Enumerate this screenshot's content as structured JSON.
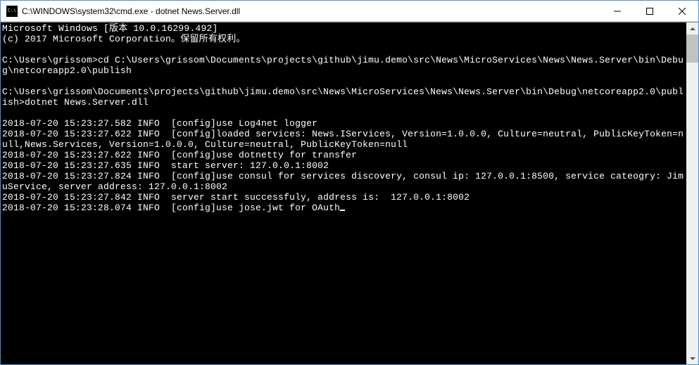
{
  "window": {
    "title": "C:\\WINDOWS\\system32\\cmd.exe - dotnet  News.Server.dll"
  },
  "terminal": {
    "lines": [
      "Microsoft Windows [版本 10.0.16299.492]",
      "(c) 2017 Microsoft Corporation。保留所有权利。",
      "",
      "C:\\Users\\grissom>cd C:\\Users\\grissom\\Documents\\projects\\github\\jimu.demo\\src\\News\\MicroServices\\News\\News.Server\\bin\\Debug\\netcoreapp2.0\\publish",
      "",
      "C:\\Users\\grissom\\Documents\\projects\\github\\jimu.demo\\src\\News\\MicroServices\\News\\News.Server\\bin\\Debug\\netcoreapp2.0\\publish>dotnet News.Server.dll",
      "",
      "2018-07-20 15:23:27.582 INFO  [config]use Log4net logger",
      "2018-07-20 15:23:27.622 INFO  [config]loaded services: News.IServices, Version=1.0.0.0, Culture=neutral, PublicKeyToken=null,News.Services, Version=1.0.0.0, Culture=neutral, PublicKeyToken=null",
      "2018-07-20 15:23:27.622 INFO  [config]use dotnetty for transfer",
      "2018-07-20 15:23:27.635 INFO  start server: 127.0.0.1:8002",
      "2018-07-20 15:23:27.824 INFO  [config]use consul for services discovery, consul ip: 127.0.0.1:8500, service cateogry: JimuService, server address: 127.0.0.1:8002",
      "2018-07-20 15:23:27.842 INFO  server start successfuly, address is:  127.0.0.1:8002",
      "2018-07-20 15:23:28.074 INFO  [config]use jose.jwt for OAuth"
    ]
  }
}
